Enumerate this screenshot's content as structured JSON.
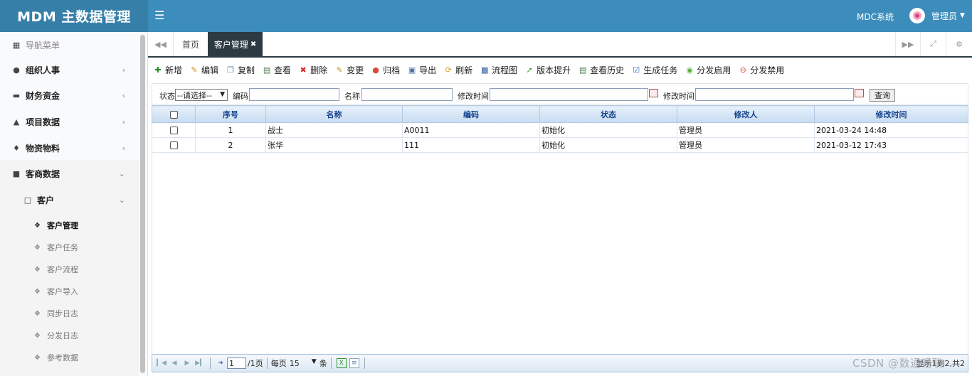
{
  "header": {
    "logo": "MDM 主数据管理",
    "menu_icon": "bars-icon",
    "system_label": "MDC系统",
    "user_name": "管理员"
  },
  "sidebar": {
    "nav_title": "导航菜单",
    "items": [
      {
        "label": "组织人事",
        "icon": "users-icon"
      },
      {
        "label": "财务资金",
        "icon": "credit-card-icon"
      },
      {
        "label": "项目数据",
        "icon": "sitemap-icon"
      },
      {
        "label": "物资物料",
        "icon": "cubes-icon"
      },
      {
        "label": "客商数据",
        "icon": "briefcase-icon"
      }
    ],
    "folder": {
      "label": "客户",
      "icon": "folder-icon"
    },
    "sub_items": [
      {
        "label": "客户管理",
        "active": true
      },
      {
        "label": "客户任务",
        "active": false
      },
      {
        "label": "客户流程",
        "active": false
      },
      {
        "label": "客户导入",
        "active": false
      },
      {
        "label": "同步日志",
        "active": false
      },
      {
        "label": "分发日志",
        "active": false
      },
      {
        "label": "参考数据",
        "active": false
      }
    ]
  },
  "tabs": {
    "home": "首页",
    "active": "客户管理",
    "close_glyph": "✖"
  },
  "toolbar": [
    {
      "label": "新增",
      "icon": "add-icon",
      "color": "#2a8f2a"
    },
    {
      "label": "编辑",
      "icon": "edit-icon",
      "color": "#c9901d"
    },
    {
      "label": "复制",
      "icon": "copy-icon",
      "color": "#5b7fb0"
    },
    {
      "label": "查看",
      "icon": "view-icon",
      "color": "#4a7a4a"
    },
    {
      "label": "删除",
      "icon": "delete-icon",
      "color": "#d42a2a"
    },
    {
      "label": "变更",
      "icon": "change-icon",
      "color": "#c9901d"
    },
    {
      "label": "归档",
      "icon": "archive-icon",
      "color": "#d94a3a"
    },
    {
      "label": "导出",
      "icon": "export-icon",
      "color": "#4a6fa0"
    },
    {
      "label": "刷新",
      "icon": "refresh-icon",
      "color": "#d9a020"
    },
    {
      "label": "流程图",
      "icon": "flowchart-icon",
      "color": "#2a5ea0"
    },
    {
      "label": "版本提升",
      "icon": "upgrade-icon",
      "color": "#4a9a30"
    },
    {
      "label": "查看历史",
      "icon": "history-icon",
      "color": "#4a7a4a"
    },
    {
      "label": "生成任务",
      "icon": "task-icon",
      "color": "#3a70b0"
    },
    {
      "label": "分发启用",
      "icon": "enable-icon",
      "color": "#5cb040"
    },
    {
      "label": "分发禁用",
      "icon": "disable-icon",
      "color": "#d9503a"
    }
  ],
  "search": {
    "status_label": "状态",
    "status_value": "--请选择--",
    "code_label": "编码",
    "name_label": "名称",
    "modified_time_label_1": "修改时间",
    "modified_time_label_2": "修改时间",
    "query_button": "查询"
  },
  "grid": {
    "columns": [
      "序号",
      "名称",
      "编码",
      "状态",
      "修改人",
      "修改时间"
    ],
    "rows": [
      {
        "no": "1",
        "name": "战士",
        "code": "A0011",
        "status": "初始化",
        "modifier": "管理员",
        "time": "2021-03-24 14:48"
      },
      {
        "no": "2",
        "name": "张华",
        "code": "111",
        "status": "初始化",
        "modifier": "管理员",
        "time": "2021-03-12 17:43"
      }
    ]
  },
  "pager": {
    "page": "1",
    "total_pages": "/1页",
    "per_page_label": "每页",
    "per_page_value": "15",
    "unit": "条",
    "info": "显示1到2,共2"
  },
  "watermark": "CSDN @数通畅联"
}
